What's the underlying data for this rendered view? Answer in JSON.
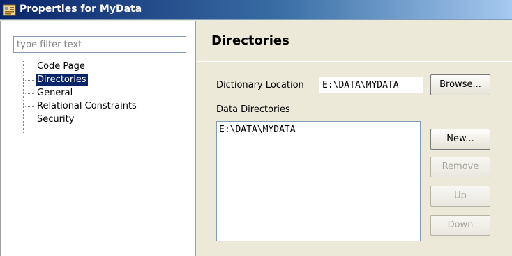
{
  "window": {
    "title": "Properties for MyData"
  },
  "filter": {
    "placeholder": "type filter text",
    "value": ""
  },
  "tree": {
    "items": [
      {
        "label": "Code Page",
        "selected": false
      },
      {
        "label": "Directories",
        "selected": true
      },
      {
        "label": "General",
        "selected": false
      },
      {
        "label": "Relational Constraints",
        "selected": false
      },
      {
        "label": "Security",
        "selected": false
      }
    ]
  },
  "page": {
    "title": "Directories",
    "dictionary_location_label": "Dictionary Location",
    "dictionary_location_value": "E:\\DATA\\MYDATA",
    "browse_label": "Browse...",
    "data_directories_label": "Data Directories",
    "data_directories": [
      "E:\\DATA\\MYDATA"
    ],
    "buttons": {
      "new": "New...",
      "remove": "Remove",
      "up": "Up",
      "down": "Down"
    }
  },
  "colors": {
    "selection": "#0a246a",
    "titlebar_start": "#0a246a",
    "dialog_background": "#ece9d8"
  },
  "icons": {
    "app": "properties-icon"
  }
}
